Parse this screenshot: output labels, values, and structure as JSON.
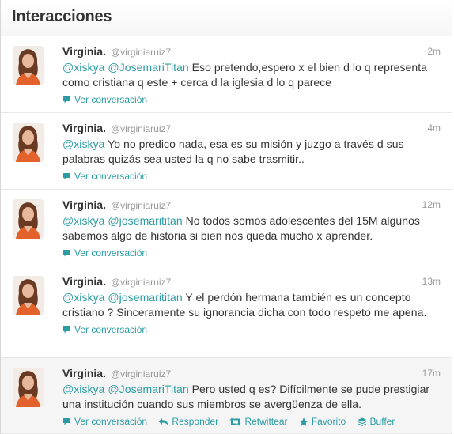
{
  "header": {
    "title": "Interacciones"
  },
  "colors": {
    "link": "#2a9ca3",
    "meta": "#999999",
    "text": "#333333"
  },
  "tweets": [
    {
      "fullname": "Virginia.",
      "username": "@virginiaruiz7",
      "time": "2m",
      "mentions": [
        "@xiskya",
        "@JosemariTitan"
      ],
      "text": " Eso pretendo,espero x el bien d lo q representa como cristiana q este + cerca d la iglesia d lo q parece",
      "actions": {
        "conversation": "Ver conversación"
      }
    },
    {
      "fullname": "Virginia.",
      "username": "@virginiaruiz7",
      "time": "4m",
      "mentions": [
        "@xiskya"
      ],
      "text": " Yo no predico nada, esa es su misión y juzgo a través d sus palabras quizás sea usted la q no sabe trasmitir..",
      "actions": {
        "conversation": "Ver conversación"
      }
    },
    {
      "fullname": "Virginia.",
      "username": "@virginiaruiz7",
      "time": "12m",
      "mentions": [
        "@xiskya",
        "@josemarititan"
      ],
      "text": " No todos somos adolescentes del 15M algunos sabemos algo de historia si bien nos queda mucho x aprender.",
      "actions": {
        "conversation": "Ver conversación"
      }
    },
    {
      "fullname": "Virginia.",
      "username": "@virginiaruiz7",
      "time": "13m",
      "mentions": [
        "@xiskya",
        "@josemarititan"
      ],
      "text": " Y el perdón hermana también es un concepto cristiano ? Sinceramente su ignorancia dicha con todo respeto me apena.",
      "actions": {
        "conversation": "Ver conversación"
      }
    },
    {
      "fullname": "Virginia.",
      "username": "@virginiaruiz7",
      "time": "17m",
      "mentions": [
        "@xiskya",
        "@JosemariTitan"
      ],
      "text": " Pero usted q es? Difícilmente se pude prestigiar una institución cuando sus miembros se avergüenza de ella.",
      "actions": {
        "conversation": "Ver conversación",
        "reply": "Responder",
        "retweet": "Retwittear",
        "favorite": "Favorito",
        "buffer": "Buffer"
      }
    }
  ]
}
